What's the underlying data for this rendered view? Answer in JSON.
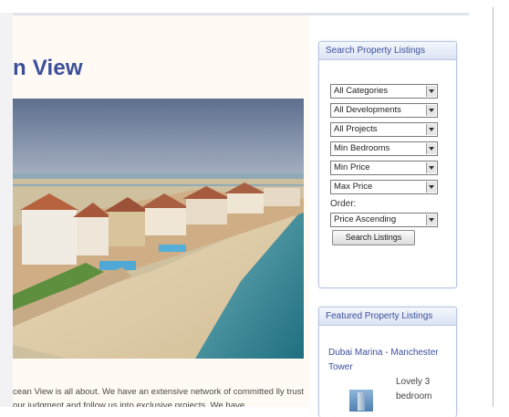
{
  "main": {
    "title": "n View",
    "intro_text": "cean View is all about. We have an extensive network of committed lly trust our judgment and follow us into exclusive projects. We have"
  },
  "search": {
    "title": "Search Property Listings",
    "selects": [
      "All Categories",
      "All Developments",
      "All Projects",
      "Min Bedrooms",
      "Min Price",
      "Max Price"
    ],
    "order_label": "Order:",
    "order_value": "Price Ascending",
    "button": "Search Listings"
  },
  "featured": {
    "title": "Featured Property Listings",
    "link": "Dubai Marina - Manchester Tower",
    "desc": "Lovely 3 bedroom"
  }
}
